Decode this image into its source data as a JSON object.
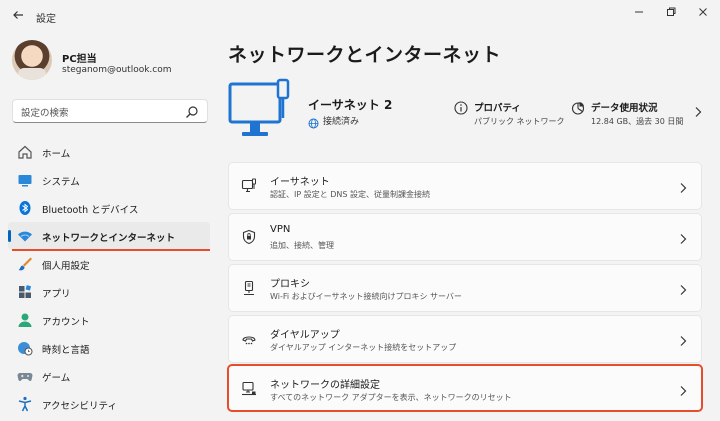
{
  "window": {
    "title": "設定",
    "back_icon": "back-arrow-icon",
    "minimize_glyph": "—",
    "maximize_glyph": "▢",
    "close_glyph": "✕"
  },
  "profile": {
    "name": "PC担当",
    "email": "steganom@outlook.com"
  },
  "search": {
    "placeholder": "設定の検索"
  },
  "sidebar": {
    "items": [
      {
        "label": "ホーム",
        "icon": "home-icon"
      },
      {
        "label": "システム",
        "icon": "system-icon"
      },
      {
        "label": "Bluetooth とデバイス",
        "icon": "bluetooth-icon"
      },
      {
        "label": "ネットワークとインターネット",
        "icon": "wifi-icon",
        "active": true
      },
      {
        "label": "個人用設定",
        "icon": "brush-icon"
      },
      {
        "label": "アプリ",
        "icon": "apps-icon"
      },
      {
        "label": "アカウント",
        "icon": "account-icon"
      },
      {
        "label": "時刻と言語",
        "icon": "globe-clock-icon"
      },
      {
        "label": "ゲーム",
        "icon": "gamepad-icon"
      },
      {
        "label": "アクセシビリティ",
        "icon": "accessibility-icon"
      }
    ]
  },
  "main": {
    "title": "ネットワークとインターネット",
    "hero": {
      "name": "イーサネット 2",
      "status": "接続済み",
      "properties": {
        "title": "プロパティ",
        "subtitle": "パブリック ネットワーク"
      },
      "data_usage": {
        "title": "データ使用状況",
        "subtitle": "12.84 GB、過去 30 日間"
      }
    },
    "cards": [
      {
        "title": "イーサネット",
        "desc": "認証、IP 設定と DNS 設定、従量制課金接続",
        "icon": "ethernet-icon"
      },
      {
        "title": "VPN",
        "desc": "追加、接続、管理",
        "icon": "vpn-shield-icon"
      },
      {
        "title": "プロキシ",
        "desc": "Wi-Fi およびイーサネット接続向けプロキシ サーバー",
        "icon": "proxy-icon"
      },
      {
        "title": "ダイヤルアップ",
        "desc": "ダイヤルアップ インターネット接続をセットアップ",
        "icon": "dialup-icon"
      },
      {
        "title": "ネットワークの詳細設定",
        "desc": "すべてのネットワーク アダプターを表示、ネットワークのリセット",
        "icon": "network-pc-icon",
        "highlighted": true
      }
    ]
  },
  "colors": {
    "accent": "#0067c0",
    "highlight": "#e74c2c",
    "background": "#f3f3f3",
    "card": "#fbfbfb"
  }
}
